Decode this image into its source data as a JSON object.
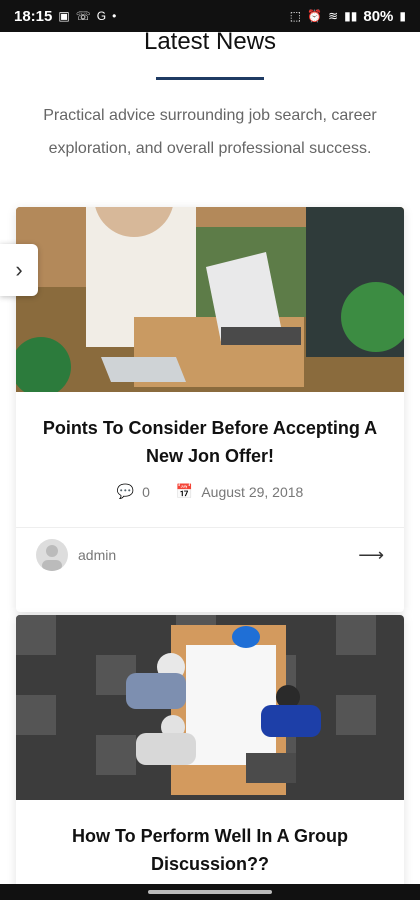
{
  "status": {
    "time": "18:15",
    "left_icons": [
      "gallery-icon",
      "wifi-call-icon",
      "g-icon",
      "dot-icon"
    ],
    "battery": "80%"
  },
  "section": {
    "title": "Latest News",
    "subtitle": "Practical advice surrounding job search, career exploration, and overall professional success."
  },
  "posts": [
    {
      "title": "Points To Consider Before Accepting A New Jon Offer!",
      "comments": "0",
      "date": "August 29, 2018",
      "author": "admin"
    },
    {
      "title": "How To Perform Well In A Group Discussion??"
    }
  ]
}
